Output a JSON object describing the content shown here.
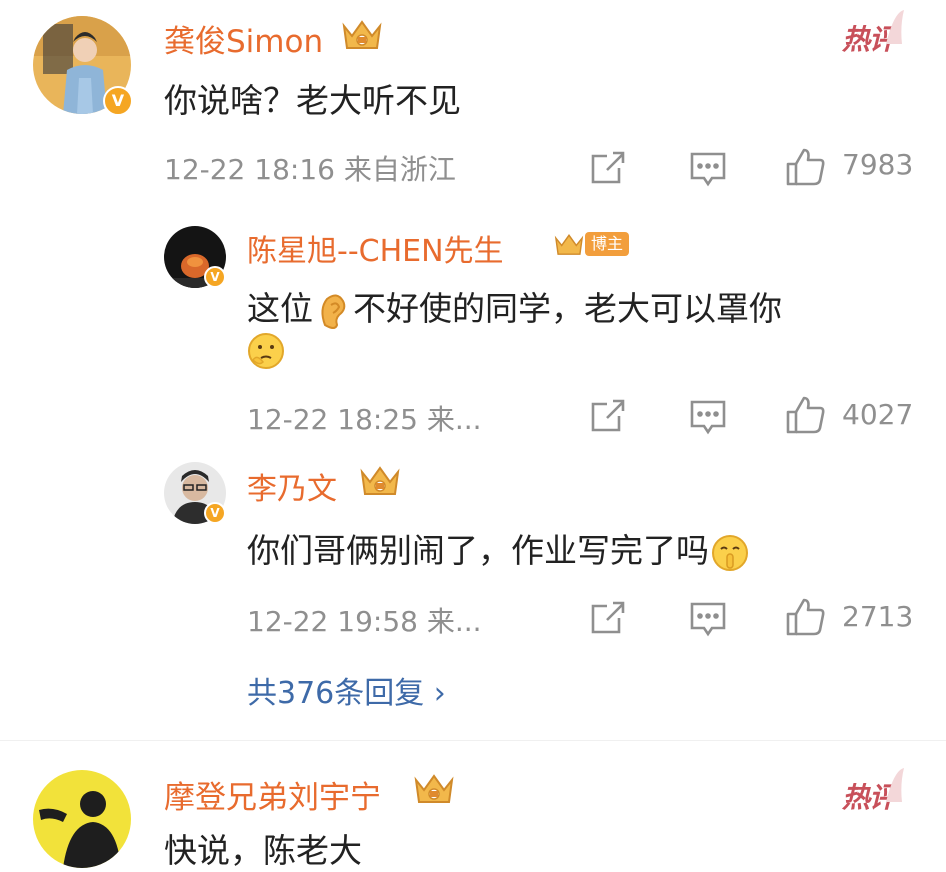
{
  "comments": [
    {
      "user": "龚俊Simon",
      "badge": "hot",
      "hot_label": "热评",
      "content": "你说啥？老大听不见",
      "meta": "12-22 18:16 来自浙江",
      "likes": "7983",
      "replies": [
        {
          "user": "陈星旭--CHEN先生",
          "tag": "博主",
          "content_before": "这位",
          "content_after": "不好使的同学，老大可以罩你",
          "meta": "12-22 18:25 来...",
          "likes": "4027"
        },
        {
          "user": "李乃文",
          "content": "你们哥俩别闹了，作业写完了吗",
          "meta": "12-22 19:58 来...",
          "likes": "2713"
        }
      ],
      "reply_summary": "共376条回复 ›"
    },
    {
      "user": "摩登兄弟刘宇宁",
      "hot_label": "热评",
      "content_partial": "快说，陈老大"
    }
  ],
  "colors": {
    "username": "#e86b2e",
    "link": "#3e6aa8",
    "meta": "#8f8f8f",
    "hot": "#c8505a"
  },
  "icons": [
    "share-icon",
    "comment-icon",
    "like-icon",
    "crown-icon",
    "verified-icon",
    "ear-emoji",
    "thinking-emoji",
    "shush-emoji"
  ]
}
